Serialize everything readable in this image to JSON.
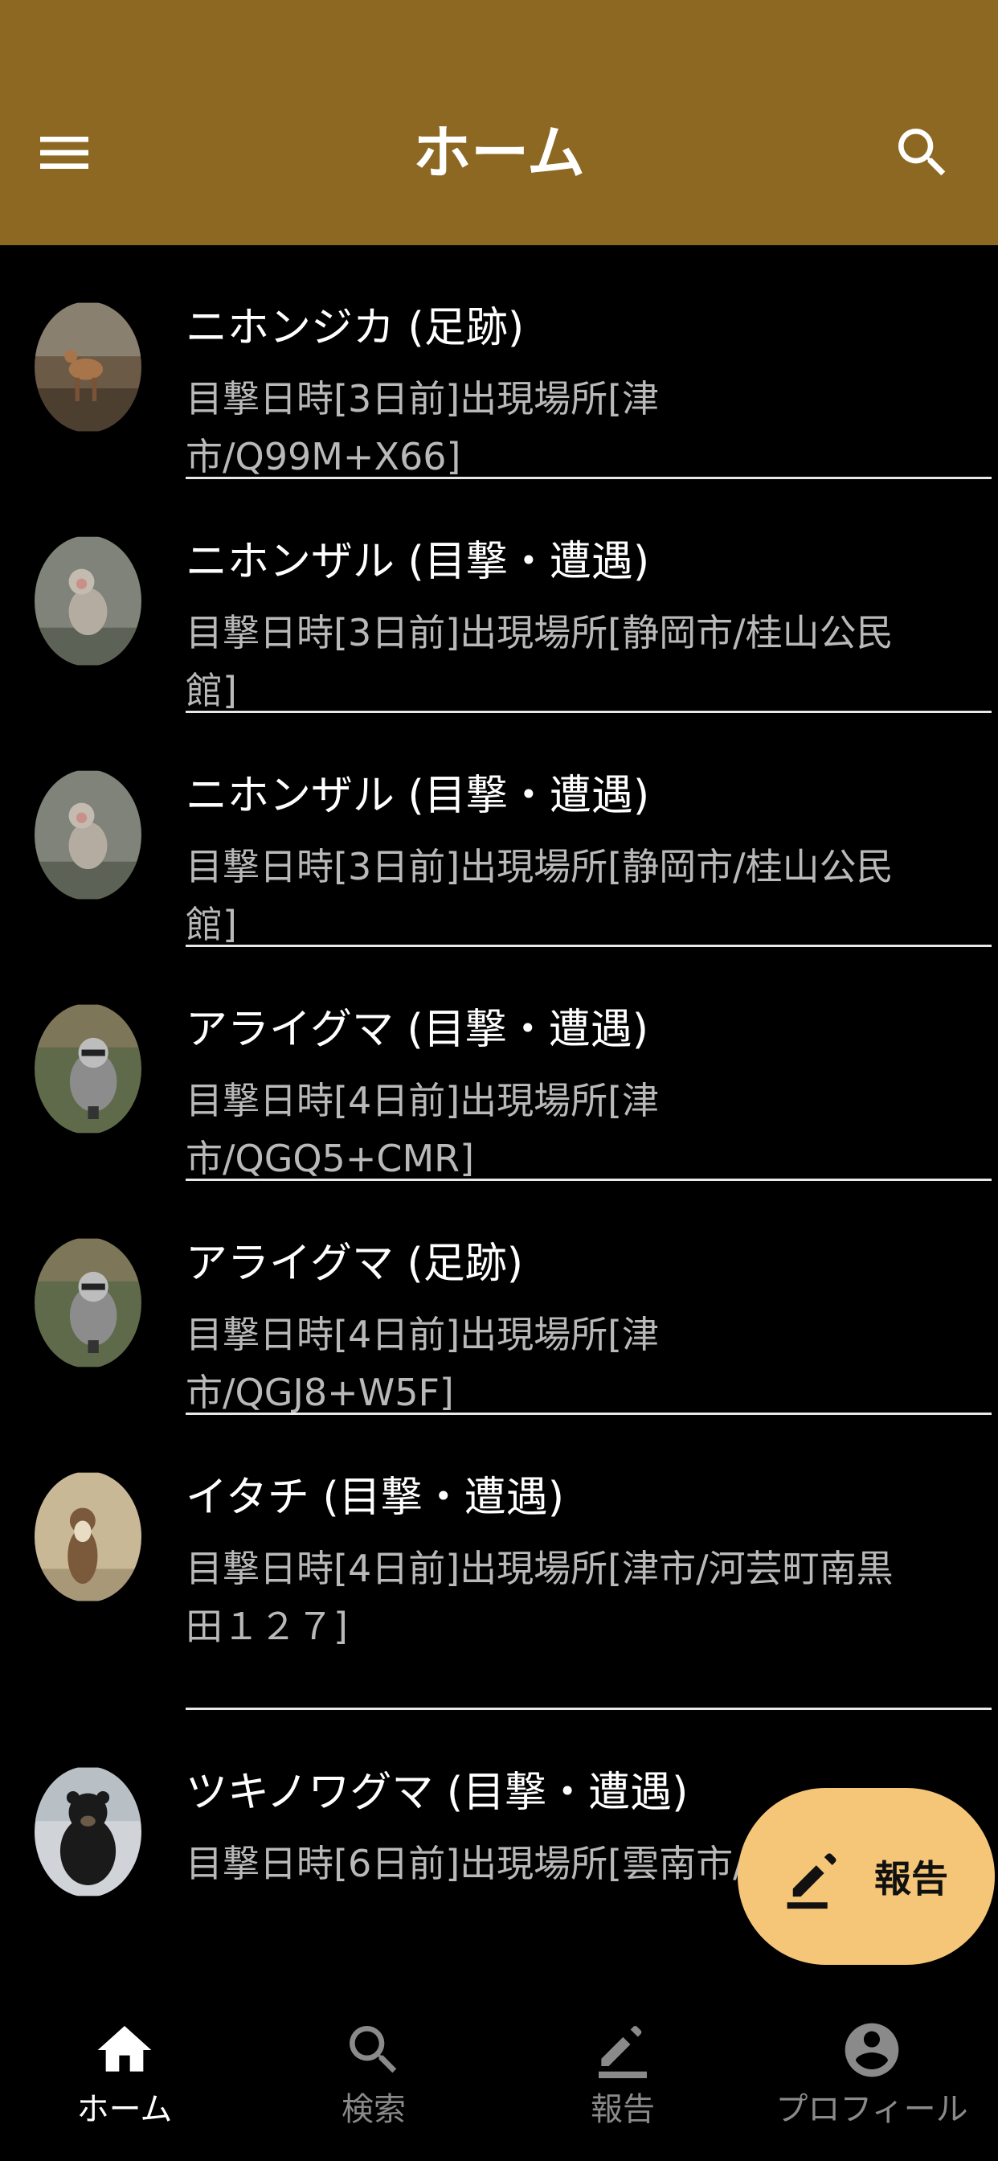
{
  "appbar": {
    "title": "ホーム"
  },
  "sightings": [
    {
      "name": "ニホンジカ (足跡)",
      "info": "目撃日時[3日前]出現場所[津市/Q99M+X66]",
      "animal": "deer"
    },
    {
      "name": "ニホンザル (目撃・遭遇)",
      "info": "目撃日時[3日前]出現場所[静岡市/桂山公民館]",
      "animal": "monkey"
    },
    {
      "name": "ニホンザル (目撃・遭遇)",
      "info": "目撃日時[3日前]出現場所[静岡市/桂山公民館]",
      "animal": "monkey"
    },
    {
      "name": "アライグマ (目撃・遭遇)",
      "info": "目撃日時[4日前]出現場所[津市/QGQ5+CMR]",
      "animal": "raccoon"
    },
    {
      "name": "アライグマ (足跡)",
      "info": "目撃日時[4日前]出現場所[津市/QGJ8+W5F]",
      "animal": "raccoon"
    },
    {
      "name": "イタチ (目撃・遭遇)",
      "info": "目撃日時[4日前]出現場所[津市/河芸町南黒田１２７]",
      "animal": "weasel"
    },
    {
      "name": "ツキノワグマ (目撃・遭遇)",
      "info": "目撃日時[6日前]出現場所[雲南市/三宮]",
      "animal": "bear"
    }
  ],
  "fab": {
    "label": "報告"
  },
  "bottom_nav": [
    {
      "label": "ホーム",
      "icon": "home-icon",
      "active": true
    },
    {
      "label": "検索",
      "icon": "search-icon",
      "active": false
    },
    {
      "label": "報告",
      "icon": "edit-icon",
      "active": false
    },
    {
      "label": "プロフィール",
      "icon": "account-circle-icon",
      "active": false
    }
  ],
  "colors": {
    "appbar": "#8c6823",
    "fab": "#f6c678",
    "background": "#000000",
    "secondary_text": "#b9b9b9",
    "inactive_nav": "#8a8a8a"
  }
}
